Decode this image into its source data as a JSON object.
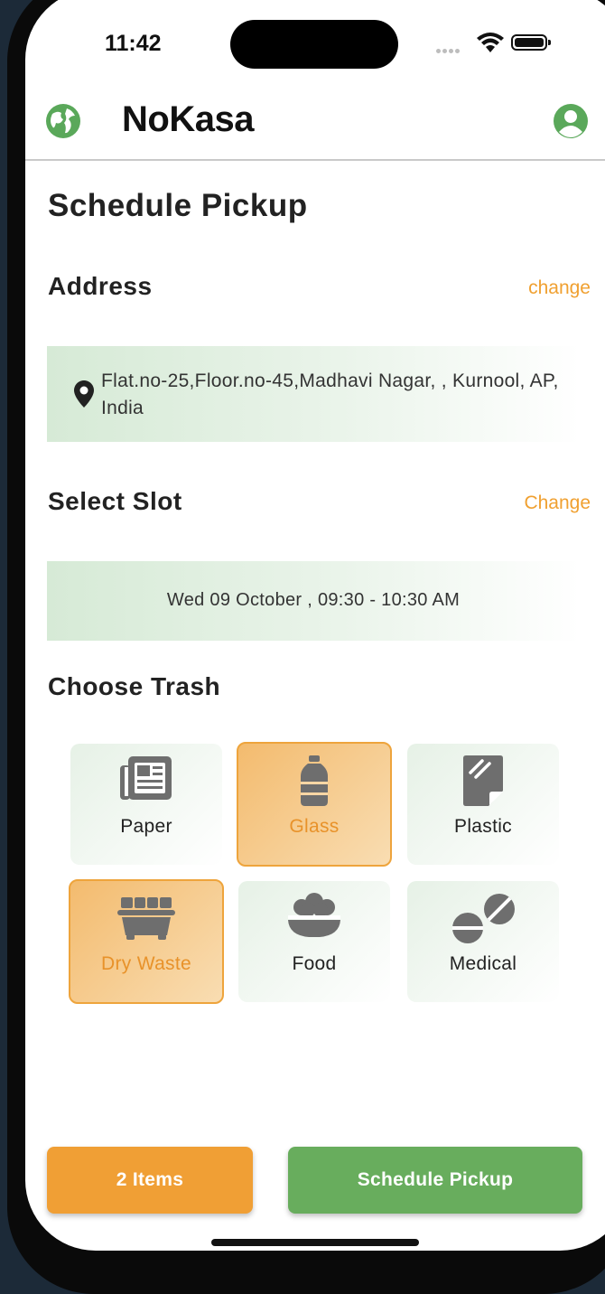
{
  "status_bar": {
    "time": "11:42"
  },
  "app_bar": {
    "title": "NoKasa"
  },
  "page": {
    "title": "Schedule Pickup"
  },
  "address": {
    "heading": "Address",
    "change_label": "change",
    "text": "Flat.no-25,Floor.no-45,Madhavi Nagar, , Kurnool, AP, India"
  },
  "slot": {
    "heading": "Select Slot",
    "change_label": "Change",
    "text": "Wed 09 October , 09:30 - 10:30 AM"
  },
  "trash": {
    "heading": "Choose Trash",
    "items": [
      {
        "label": "Paper",
        "icon": "newspaper-icon",
        "selected": false
      },
      {
        "label": "Glass",
        "icon": "bottle-icon",
        "selected": true
      },
      {
        "label": "Plastic",
        "icon": "plastic-sheet-icon",
        "selected": false
      },
      {
        "label": "Dry Waste",
        "icon": "dumpster-icon",
        "selected": true
      },
      {
        "label": "Food",
        "icon": "food-bowl-icon",
        "selected": false
      },
      {
        "label": "Medical",
        "icon": "pills-icon",
        "selected": false
      }
    ]
  },
  "footer": {
    "items_label": "2 Items",
    "schedule_label": "Schedule Pickup"
  },
  "colors": {
    "accent_orange": "#f09f35",
    "accent_green": "#68ad5d",
    "icon_grey": "#6e6e6e"
  }
}
